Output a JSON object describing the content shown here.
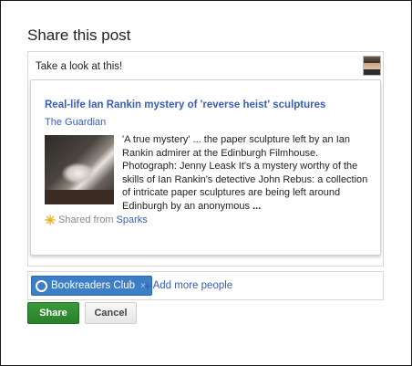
{
  "dialog": {
    "title": "Share this post"
  },
  "comment": {
    "text": "Take a look at this!"
  },
  "card": {
    "title": "Real-life Ian Rankin mystery of 'reverse heist' sculptures",
    "source": "The Guardian",
    "description": "'A true mystery' ... the paper sculpture left by an Ian Rankin admirer at the Edinburgh Filmhouse. Photograph: Jenny Leask It's a mystery worthy of the skills of Ian Rankin's detective John Rebus: a collection of intricate paper sculptures are being left around Edinburgh by an anonymous",
    "more": "...",
    "shared_prefix": "Shared from",
    "shared_link": "Sparks",
    "icon": "sparks-icon"
  },
  "audience": {
    "chip_label": "Bookreaders Club",
    "chip_remove": "×",
    "add_more_plus": "+",
    "add_more_label": "Add more people"
  },
  "buttons": {
    "share_label": "Share",
    "cancel_label": "Cancel"
  },
  "colors": {
    "link": "#3b5db7",
    "share_button": "#2e8b2e",
    "chip": "#3d7fc6"
  }
}
